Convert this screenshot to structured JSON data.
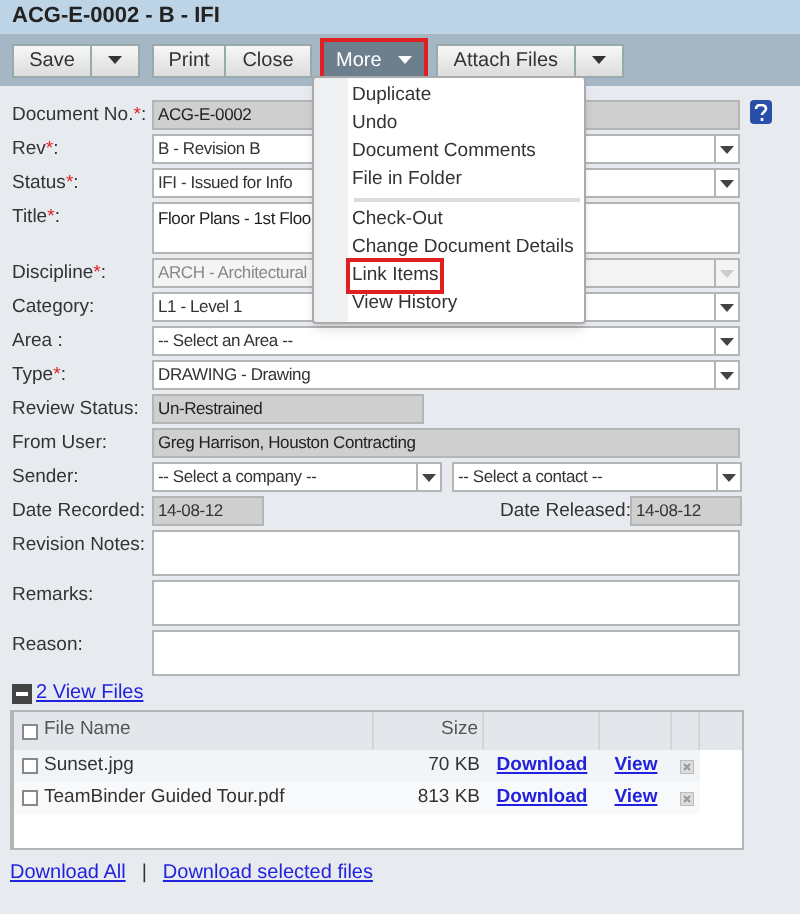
{
  "window": {
    "title": "ACG-E-0002 - B - IFI"
  },
  "toolbar": [
    {
      "kind": "split",
      "label": "Save",
      "active": false
    },
    {
      "kind": "group",
      "labels": [
        "Print",
        "Close"
      ],
      "active": false
    },
    {
      "kind": "menu",
      "label": "More",
      "active": true
    },
    {
      "kind": "split",
      "label": "Attach Files",
      "active": false
    }
  ],
  "menu": {
    "sections": [
      [
        {
          "label": "Duplicate",
          "highlighted": false
        },
        {
          "label": "Undo",
          "highlighted": false
        },
        {
          "label": "Document Comments",
          "highlighted": false
        },
        {
          "label": "File in Folder",
          "highlighted": false
        }
      ],
      [
        {
          "label": "Check-Out",
          "highlighted": false
        },
        {
          "label": "Change Document Details",
          "highlighted": false
        },
        {
          "label": "Link Items",
          "highlighted": true
        },
        {
          "label": "View History",
          "highlighted": false
        }
      ]
    ]
  },
  "fields": [
    {
      "kind": "text",
      "label": "Document No.",
      "required_mark": "*",
      "label_end": ":",
      "value": "ACG-E-0002",
      "readonly": true,
      "help": true
    },
    {
      "kind": "select",
      "label": "Rev",
      "required_mark": "*",
      "label_end": ":",
      "value": "B - Revision B",
      "disabled": false
    },
    {
      "kind": "select",
      "label": "Status",
      "required_mark": "*",
      "label_end": ":",
      "value": "IFI - Issued for Info",
      "disabled": false
    },
    {
      "kind": "textarea",
      "label": "Title",
      "required_mark": "*",
      "label_end": ":",
      "value": "Floor Plans - 1st Floo"
    },
    {
      "kind": "select",
      "label": "Discipline",
      "required_mark": "*",
      "label_end": ":",
      "value": "ARCH - Architectural",
      "disabled": true
    },
    {
      "kind": "select",
      "label": "Category:",
      "value": "L1 - Level 1",
      "disabled": false
    },
    {
      "kind": "select",
      "label": "Area :",
      "value": "-- Select an Area --",
      "disabled": false
    },
    {
      "kind": "select",
      "label": "Type",
      "required_mark": "*",
      "label_end": ":",
      "value": "DRAWING - Drawing",
      "disabled": false
    },
    {
      "kind": "short-text",
      "label": "Review Status:",
      "value": "Un-Restrained",
      "readonly": true
    },
    {
      "kind": "text",
      "label": "From User:",
      "value": "Greg Harrison, Houston Contracting",
      "readonly": true
    },
    {
      "kind": "select-pair",
      "label": "Sender:",
      "values": [
        "-- Select a company --",
        "-- Select a contact --"
      ]
    },
    {
      "kind": "date-pair",
      "label": "Date Recorded:",
      "value": "14-08-12",
      "label_2": "Date Released:",
      "value_2": "14-08-12"
    },
    {
      "kind": "textarea",
      "label": "Revision Notes:"
    },
    {
      "kind": "textarea",
      "label": "Remarks:"
    },
    {
      "kind": "textarea",
      "label": "Reason:"
    }
  ],
  "files": {
    "expanded": true,
    "link": "2 View Files",
    "columns": [
      "File Name",
      "Size"
    ],
    "all_checked": false,
    "rows": [
      {
        "name": "Sunset.jpg",
        "size": "70 KB",
        "download": "Download",
        "view": "View",
        "checked": false
      },
      {
        "name": "TeamBinder Guided Tour.pdf",
        "size": "813 KB",
        "download": "Download",
        "view": "View",
        "checked": false
      }
    ]
  },
  "footer_links": [
    "Download All",
    "Download selected files"
  ],
  "footer_separator": "|"
}
